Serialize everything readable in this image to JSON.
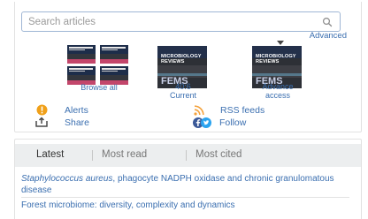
{
  "search": {
    "placeholder": "Search articles",
    "advanced_label": "Advanced"
  },
  "covers": [
    {
      "label": "Browse all"
    },
    {
      "label_line1": "40:6",
      "label_line2": "Current",
      "cover_title": "MICROBIOLOGY REVIEWS",
      "cover_brand": "FEMS"
    },
    {
      "label_line1": "Advance",
      "label_line2": "access",
      "cover_title": "MICROBIOLOGY REVIEWS",
      "cover_brand": "FEMS"
    }
  ],
  "actions": {
    "alerts": "Alerts",
    "rss": "RSS feeds",
    "share": "Share",
    "follow": "Follow"
  },
  "tabs": [
    "Latest",
    "Most read",
    "Most cited"
  ],
  "articles": [
    {
      "title_italic": "Staphylococcus aureus",
      "title_rest": ", phagocyte NADPH oxidase and chronic granulomatous disease"
    },
    {
      "title": "Forest microbiome: diversity, complexity and dynamics"
    }
  ],
  "colors": {
    "link": "#3b6fb0",
    "alert_icon": "#f0a019",
    "rss_icon": "#f4a23c",
    "follow_facebook": "#3b5998",
    "follow_twitter": "#2aa3ef"
  }
}
